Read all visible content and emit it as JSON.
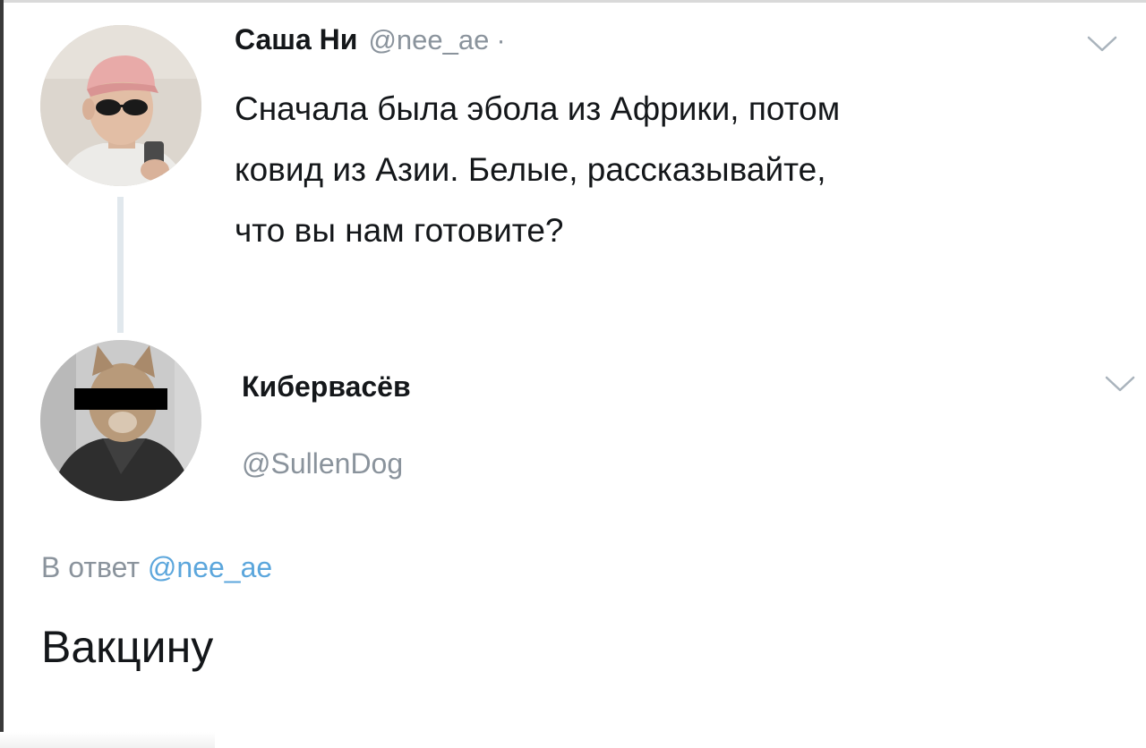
{
  "tweet1": {
    "author_name": "Саша Ни",
    "author_handle": "@nee_ae",
    "separator": "·",
    "text": "Сначала была эбола из Африки, потом\nковид из Азии. Белые, рассказывайте,\nчто вы нам готовите?",
    "menu_icon": "chevron-down-icon"
  },
  "tweet2": {
    "author_name": "Кибервасёв",
    "author_handle": "@SullenDog",
    "reply_prefix": "В ответ",
    "reply_handle": "@nee_ae",
    "text": "Вакцину",
    "menu_icon": "chevron-down-icon"
  },
  "colors": {
    "text": "#14171a",
    "muted": "#8a939c",
    "link": "#5ba6dc",
    "thread_line": "#e1e8ed"
  }
}
